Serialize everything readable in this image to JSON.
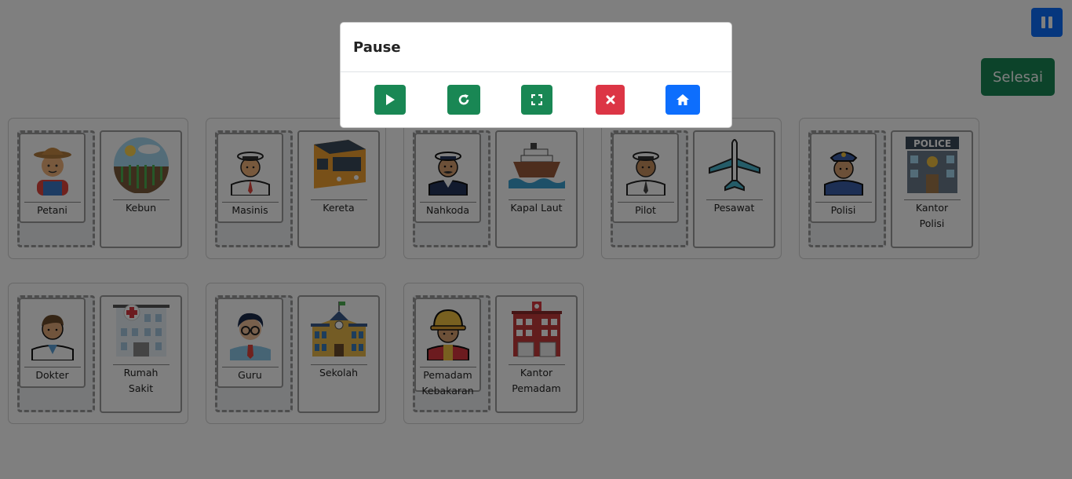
{
  "controls": {
    "finish_label": "Selesai",
    "pause_icon": "pause-icon"
  },
  "groups": [
    {
      "person": {
        "label": "Petani",
        "icon": "farmer-icon"
      },
      "place": {
        "label": "Kebun",
        "icon": "garden-icon"
      }
    },
    {
      "person": {
        "label": "Masinis",
        "icon": "train-driver-icon"
      },
      "place": {
        "label": "Kereta",
        "icon": "train-icon"
      }
    },
    {
      "person": {
        "label": "Nahkoda",
        "icon": "captain-icon"
      },
      "place": {
        "label": "Kapal Laut",
        "icon": "ship-icon"
      }
    },
    {
      "person": {
        "label": "Pilot",
        "icon": "pilot-icon"
      },
      "place": {
        "label": "Pesawat",
        "icon": "airplane-icon"
      }
    },
    {
      "person": {
        "label": "Polisi",
        "icon": "police-officer-icon"
      },
      "place": {
        "label": "Kantor\nPolisi",
        "icon": "police-station-icon",
        "sign": "POLICE"
      }
    },
    {
      "person": {
        "label": "Dokter",
        "icon": "doctor-icon"
      },
      "place": {
        "label": "Rumah\nSakit",
        "icon": "hospital-icon"
      }
    },
    {
      "person": {
        "label": "Guru",
        "icon": "teacher-icon"
      },
      "place": {
        "label": "Sekolah",
        "icon": "school-icon"
      }
    },
    {
      "person": {
        "label": "Pemadam\nKebakaran",
        "icon": "firefighter-icon"
      },
      "place": {
        "label": "Kantor\nPemadam",
        "icon": "fire-station-icon"
      }
    }
  ],
  "pause_dialog": {
    "title": "Pause",
    "buttons": [
      {
        "name": "resume",
        "icon": "play-icon",
        "color": "#198754"
      },
      {
        "name": "restart",
        "icon": "restart-icon",
        "color": "#198754"
      },
      {
        "name": "fullscreen",
        "icon": "fullscreen-icon",
        "color": "#198754"
      },
      {
        "name": "exit",
        "icon": "close-icon",
        "color": "#dc3545"
      },
      {
        "name": "home",
        "icon": "home-icon",
        "color": "#0d6efd"
      }
    ]
  }
}
